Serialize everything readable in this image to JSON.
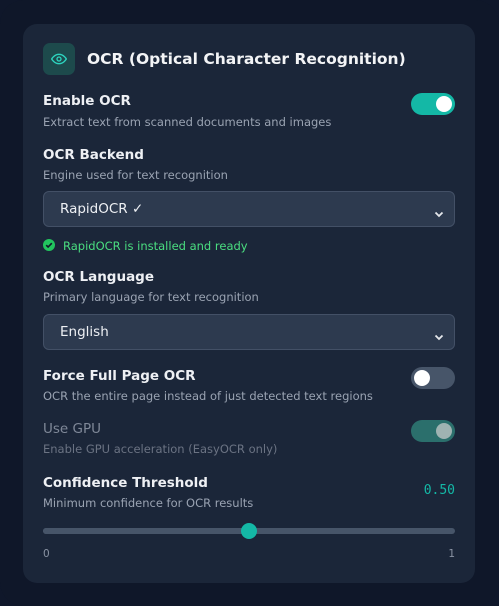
{
  "header": {
    "title": "OCR (Optical Character Recognition)",
    "icon": "eye-icon"
  },
  "enable_ocr": {
    "label": "Enable OCR",
    "description": "Extract text from scanned documents and images",
    "checked": true
  },
  "backend": {
    "label": "OCR Backend",
    "description": "Engine used for text recognition",
    "selected": "RapidOCR ✓",
    "status": "RapidOCR is installed and ready"
  },
  "language": {
    "label": "OCR Language",
    "description": "Primary language for text recognition",
    "selected": "English"
  },
  "force_full_page": {
    "label": "Force Full Page OCR",
    "description": "OCR the entire page instead of just detected text regions",
    "checked": false
  },
  "use_gpu": {
    "label": "Use GPU",
    "description": "Enable GPU acceleration (EasyOCR only)",
    "checked": true,
    "disabled": true
  },
  "confidence": {
    "label": "Confidence Threshold",
    "description": "Minimum confidence for OCR results",
    "value_text": "0.50",
    "value": 0.5,
    "min_label": "0",
    "max_label": "1"
  },
  "colors": {
    "accent": "#14b8a6",
    "success": "#4ade80",
    "card": "#1b2639"
  }
}
